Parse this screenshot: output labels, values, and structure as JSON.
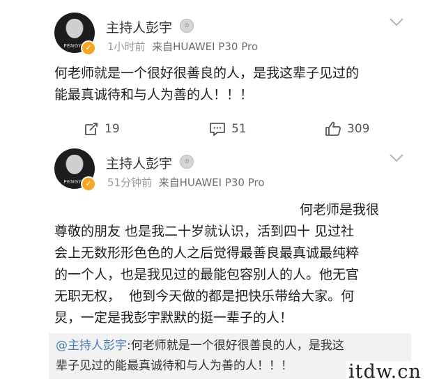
{
  "posts": [
    {
      "avatar_brand": "PENGYU",
      "username": "主持人彭宇",
      "time": "1小时前",
      "source": "来自HUAWEI P30 Pro",
      "content_lines": [
        "何老师就是一个很好很善良的人，是我这辈子见过的",
        "能最真诚待和与人为善的人！！！"
      ],
      "actions": {
        "repost": "19",
        "comment": "51",
        "like": "309"
      }
    },
    {
      "avatar_brand": "PENGYU",
      "username": "主持人彭宇",
      "time": "51分钟前",
      "source": "来自HUAWEI P30 Pro",
      "content_lines": [
        "何老师是我很",
        "尊敬的朋友 也是我二十岁就认识，活到四十 见过社",
        "会上无数形形色色的人之后觉得最善良最真诚最纯粹",
        "的一个人，也是我见过的最能包容别人的人。他无官",
        "无职无权，  他到今天做的都是把快乐带给大家。何",
        "炅，一定是我彭宇默默的挺一辈子的人！"
      ],
      "quote": {
        "user": "@主持人彭宇",
        "line1_rest": ":何老师就是一个很好很善良的人，是我这",
        "line2": "辈子见过的能最真诚待和与人为善的人！！！"
      }
    }
  ],
  "watermark": "itdw.cn",
  "colors": {
    "verified": "#f5a623",
    "quote_user": "#4a7eb7",
    "meta": "#9a9a9a"
  }
}
